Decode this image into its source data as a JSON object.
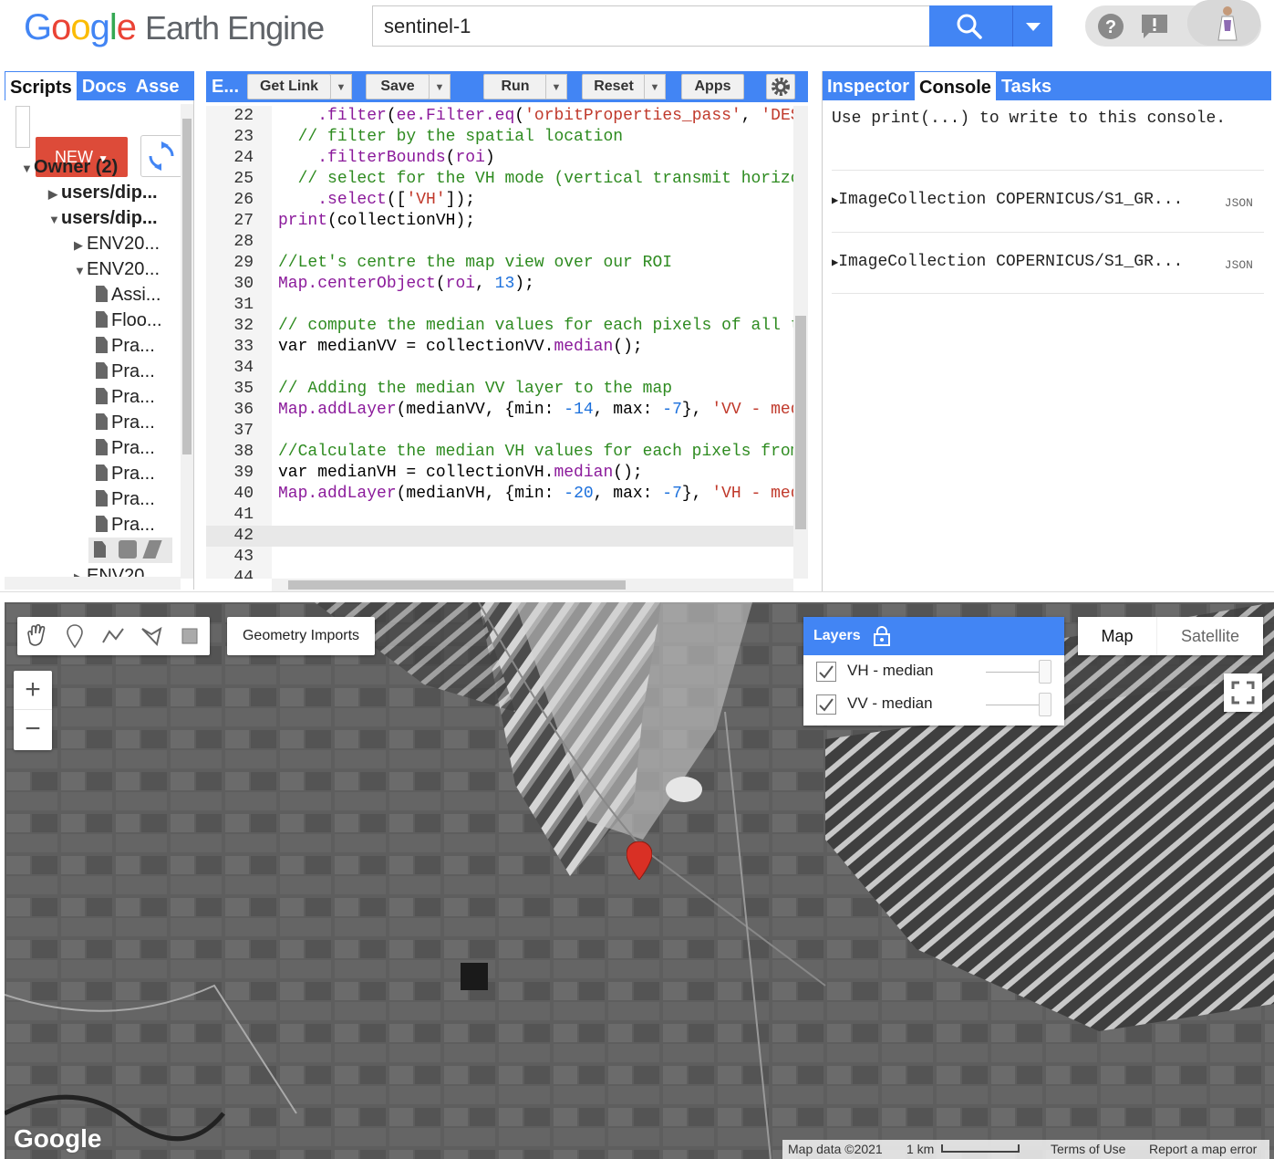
{
  "header": {
    "logo_google": [
      "G",
      "o",
      "o",
      "g",
      "l",
      "e"
    ],
    "logo_product": "Earth Engine",
    "search_value": "sentinel-1"
  },
  "left_panel": {
    "tabs": [
      "Scripts",
      "Docs",
      "Asse"
    ],
    "new_label": "NEW",
    "tree": [
      {
        "label": "Owner (2)",
        "arrow": "▼",
        "bold": true
      },
      {
        "label": "users/dip...",
        "arrow": "▶",
        "bold": true
      },
      {
        "label": "users/dip...",
        "arrow": "▼",
        "bold": true
      },
      {
        "label": "ENV20...",
        "arrow": "▶"
      },
      {
        "label": "ENV20...",
        "arrow": "▼"
      },
      {
        "label": "Assi..."
      },
      {
        "label": "Floo..."
      },
      {
        "label": "Pra..."
      },
      {
        "label": "Pra..."
      },
      {
        "label": "Pra..."
      },
      {
        "label": "Pra..."
      },
      {
        "label": "Pra..."
      },
      {
        "label": "Pra..."
      },
      {
        "label": "Pra..."
      },
      {
        "label": "Pra..."
      },
      {
        "label": ""
      },
      {
        "label": "ENV20...",
        "arrow": "▶"
      }
    ]
  },
  "editor": {
    "tab_label": "E...",
    "buttons": {
      "get_link": "Get Link",
      "save": "Save",
      "run": "Run",
      "reset": "Reset",
      "apps": "Apps"
    },
    "lines": [
      {
        "n": "22",
        "html": "    <span class='fn'>.filter</span>(<span class='fn'>ee.Filter.eq</span>(<span class='st'>'orbitProperties_pass'</span>, <span class='st'>'DES</span>"
      },
      {
        "n": "23",
        "html": "  <span class='cm'>// filter by the spatial location</span>"
      },
      {
        "n": "24",
        "html": "    <span class='fn'>.filterBounds</span>(<span class='fn'>roi</span>)"
      },
      {
        "n": "25",
        "html": "  <span class='cm'>// select for the VH mode (vertical transmit horizo</span>"
      },
      {
        "n": "26",
        "html": "    <span class='fn'>.select</span>([<span class='st'>'VH'</span>]);"
      },
      {
        "n": "27",
        "html": "<span class='fn'>print</span>(collectionVH);"
      },
      {
        "n": "28",
        "html": ""
      },
      {
        "n": "29",
        "html": "<span class='cm'>//Let's centre the map view over our ROI</span>"
      },
      {
        "n": "30",
        "html": "<span class='fn'>Map.centerObject</span>(<span class='fn'>roi</span>, <span class='nm'>13</span>);"
      },
      {
        "n": "31",
        "html": ""
      },
      {
        "n": "32",
        "html": "<span class='cm'>// compute the median values for each pixels of all t</span>"
      },
      {
        "n": "33",
        "html": "var medianVV = collectionVV.<span class='fn'>median</span>();"
      },
      {
        "n": "34",
        "html": ""
      },
      {
        "n": "35",
        "html": "<span class='cm'>// Adding the median VV layer to the map</span>"
      },
      {
        "n": "36",
        "html": "<span class='fn'>Map.addLayer</span>(medianVV, {min: <span class='nm'>-14</span>, max: <span class='nm'>-7</span>}, <span class='st'>'VV - med</span>"
      },
      {
        "n": "37",
        "html": ""
      },
      {
        "n": "38",
        "html": "<span class='cm'>//Calculate the median VH values for each pixels from</span>"
      },
      {
        "n": "39",
        "html": "var medianVH = collectionVH.<span class='fn'>median</span>();"
      },
      {
        "n": "40",
        "html": "<span class='fn'>Map.addLayer</span>(medianVH, {min: <span class='nm'>-20</span>, max: <span class='nm'>-7</span>}, <span class='st'>'VH - med</span>"
      },
      {
        "n": "41",
        "html": ""
      },
      {
        "n": "42",
        "html": ""
      },
      {
        "n": "43",
        "html": ""
      },
      {
        "n": "44",
        "html": ""
      }
    ],
    "current_line": "42"
  },
  "right_panel": {
    "tabs": [
      "Inspector",
      "Console",
      "Tasks"
    ],
    "active_tab": "Console",
    "console_message": "Use print(...) to write to this console.",
    "entries": [
      {
        "text": "ImageCollection COPERNICUS/S1_GR...",
        "badge": "JSON"
      },
      {
        "text": "ImageCollection COPERNICUS/S1_GR...",
        "badge": "JSON"
      }
    ]
  },
  "map": {
    "geometry_imports": "Geometry Imports",
    "zoom_in": "+",
    "zoom_out": "−",
    "layers_title": "Layers",
    "layers": [
      {
        "name": "VH - median",
        "checked": true
      },
      {
        "name": "VV - median",
        "checked": true
      }
    ],
    "map_type_map": "Map",
    "map_type_satellite": "Satellite",
    "watermark": "Google",
    "footer": {
      "data": "Map data ©2021",
      "scale": "1 km",
      "terms": "Terms of Use",
      "report": "Report a map error"
    }
  },
  "colors": {
    "accent": "#4285f4",
    "new_button": "#dd4b39",
    "marker": "#d93025"
  }
}
